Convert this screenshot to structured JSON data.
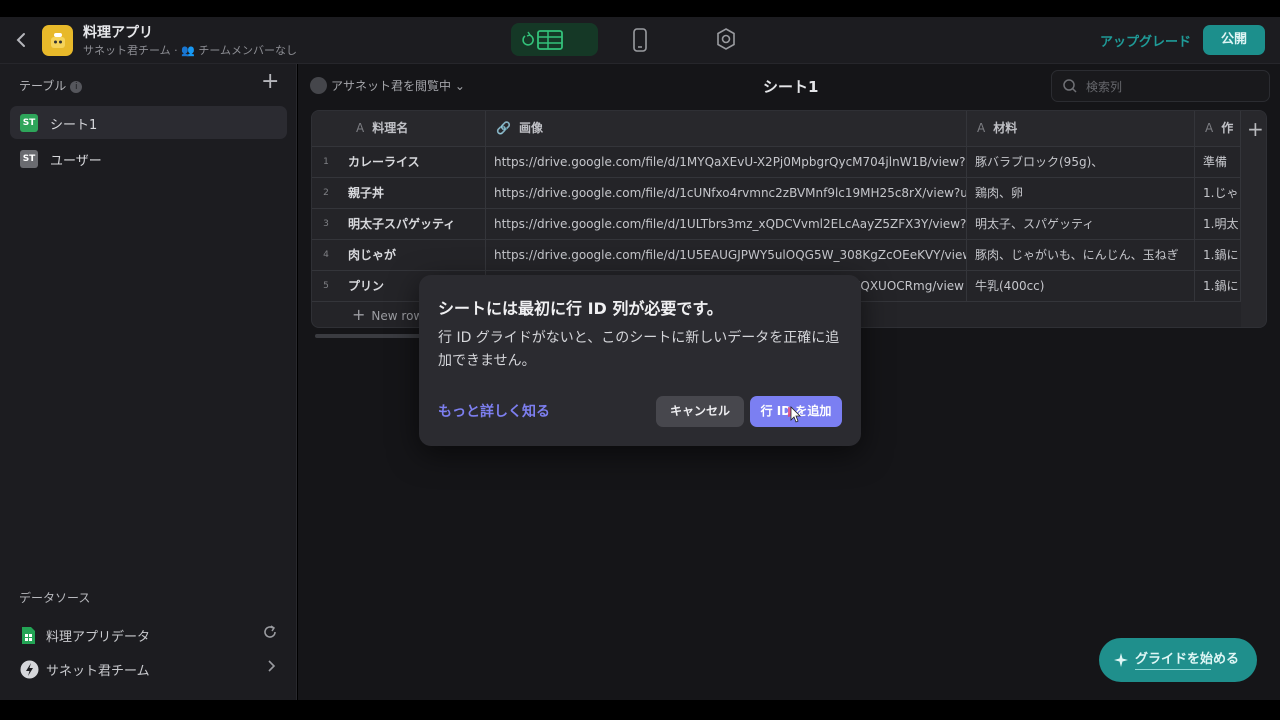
{
  "header": {
    "back_label": "‹",
    "app_title": "料理アプリ",
    "app_subtitle": "サネット君チーム · 👥 チームメンバーなし",
    "upgrade_label": "アップグレード",
    "publish_label": "公開"
  },
  "sidebar": {
    "tables_heading": "テーブル",
    "add_label": "+",
    "tables": [
      {
        "label": "シート1",
        "icon_text": "ST"
      },
      {
        "label": "ユーザー",
        "icon_text": "ST"
      }
    ],
    "data_sources_heading": "データソース",
    "data_sources": [
      {
        "label": "料理アプリデータ",
        "icon": "google-sheets-icon",
        "action": "refresh-icon"
      },
      {
        "label": "サネット君チーム",
        "icon": "glide-logo-icon",
        "action": "chevron-right-icon"
      }
    ]
  },
  "toolbar": {
    "viewer_label": "アサネット君を閲覧中",
    "sheet_title": "シート1",
    "search_placeholder": "検索列"
  },
  "grid": {
    "columns": [
      {
        "type": "A",
        "label": "料理名"
      },
      {
        "type": "🔗",
        "label": "画像"
      },
      {
        "type": "A",
        "label": "材料"
      },
      {
        "type": "A",
        "label": "作"
      }
    ],
    "rows": [
      {
        "num": "1",
        "name": "カレーライス",
        "image": "https://drive.google.com/file/d/1MYQaXEvU-X2Pj0MpbgrQycM704jlnW1B/view?u",
        "ingredients": "豚バラブロック(95g)、",
        "steps": "準備"
      },
      {
        "num": "2",
        "name": "親子丼",
        "image": "https://drive.google.com/file/d/1cUNfxo4rvmnc2zBVMnf9lc19MH25c8rX/view?u",
        "ingredients": "鶏肉、卵",
        "steps": "1.じゃ"
      },
      {
        "num": "3",
        "name": "明太子スパゲッティ",
        "image": "https://drive.google.com/file/d/1ULTbrs3mz_xQDCVvml2ELcAayZ5ZFX3Y/view?u",
        "ingredients": "明太子、スパゲッティ",
        "steps": "1.明太"
      },
      {
        "num": "4",
        "name": "肉じゃが",
        "image": "https://drive.google.com/file/d/1U5EAUGJPWY5ulOQG5W_308KgZcOEeKVY/view",
        "ingredients": "豚肉、じゃがいも、にんじん、玉ねぎ",
        "steps": "1.鍋に"
      },
      {
        "num": "5",
        "name": "プリン",
        "image": "EQXUOCRmg/view",
        "ingredients": "牛乳(400cc)",
        "steps": "1.鍋に"
      }
    ],
    "new_row_label": "New row"
  },
  "dialog": {
    "title": "シートには最初に行 ID 列が必要です。",
    "body": "行 ID グライドがないと、このシートに新しいデータを正確に追加できません。",
    "learn_more": "もっと詳しく知る",
    "cancel": "キャンセル",
    "confirm": "行 ID を追加"
  },
  "cta": {
    "label": "グライドを始める"
  },
  "colors": {
    "accent_teal": "#1c8f8c",
    "dialog_primary": "#7b7ff2",
    "link_purple": "#7d7ff0",
    "data_mode_green": "#33c27a"
  }
}
